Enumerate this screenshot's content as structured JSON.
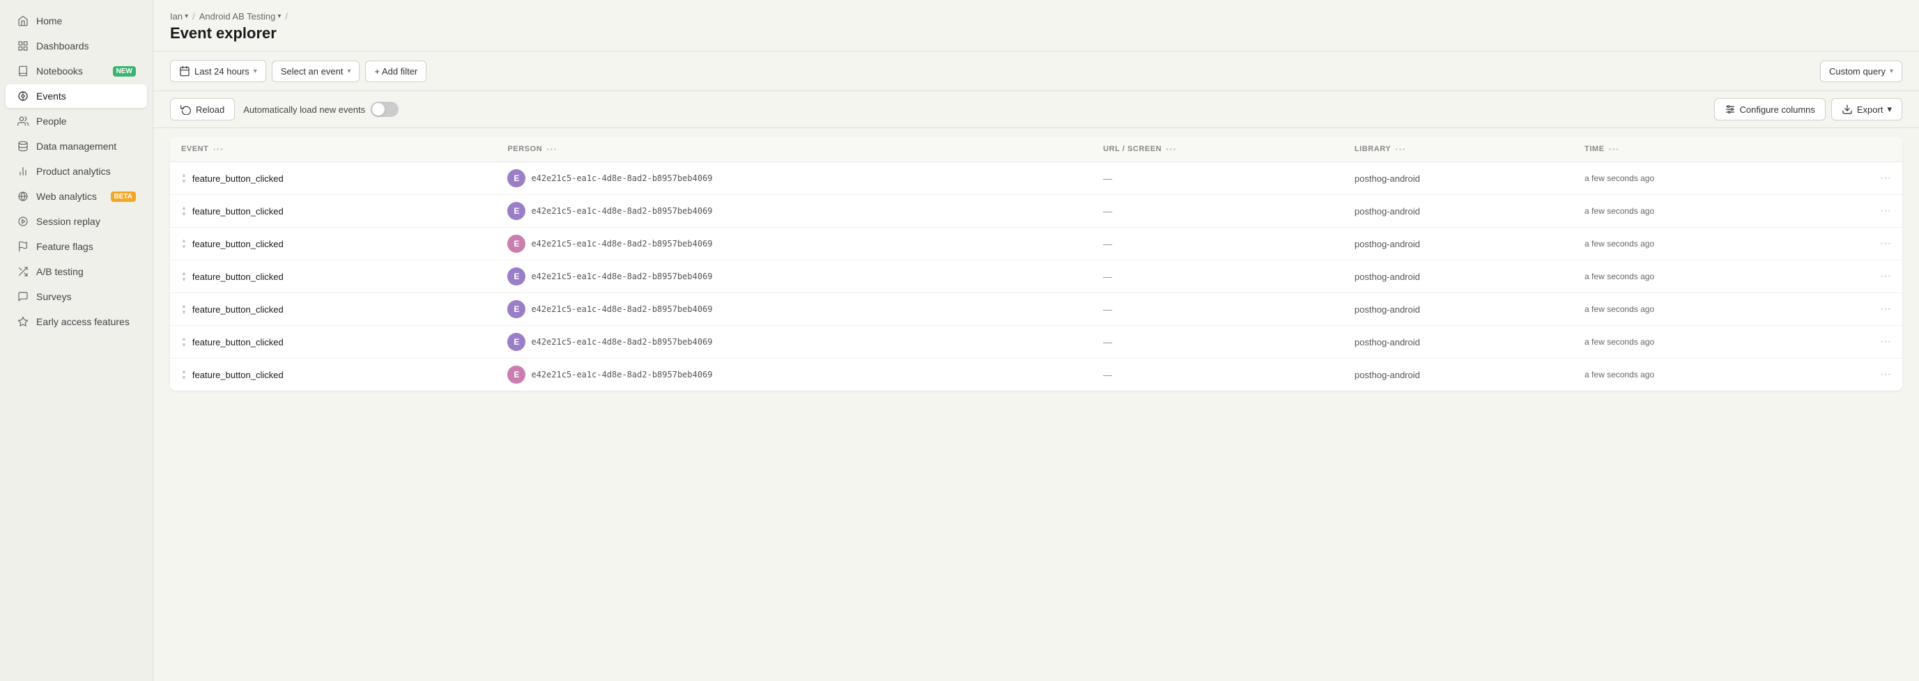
{
  "sidebar": {
    "items": [
      {
        "id": "home",
        "label": "Home",
        "icon": "home-icon",
        "active": false,
        "badge": null
      },
      {
        "id": "dashboards",
        "label": "Dashboards",
        "icon": "dashboard-icon",
        "active": false,
        "badge": null
      },
      {
        "id": "notebooks",
        "label": "Notebooks",
        "icon": "notebook-icon",
        "active": false,
        "badge": "NEW"
      },
      {
        "id": "events",
        "label": "Events",
        "icon": "events-icon",
        "active": true,
        "badge": null
      },
      {
        "id": "people",
        "label": "People",
        "icon": "people-icon",
        "active": false,
        "badge": null
      },
      {
        "id": "data-management",
        "label": "Data management",
        "icon": "data-icon",
        "active": false,
        "badge": null
      },
      {
        "id": "product-analytics",
        "label": "Product analytics",
        "icon": "analytics-icon",
        "active": false,
        "badge": null
      },
      {
        "id": "web-analytics",
        "label": "Web analytics",
        "icon": "web-icon",
        "active": false,
        "badge": "BETA"
      },
      {
        "id": "session-replay",
        "label": "Session replay",
        "icon": "replay-icon",
        "active": false,
        "badge": null
      },
      {
        "id": "feature-flags",
        "label": "Feature flags",
        "icon": "flags-icon",
        "active": false,
        "badge": null
      },
      {
        "id": "ab-testing",
        "label": "A/B testing",
        "icon": "ab-icon",
        "active": false,
        "badge": null
      },
      {
        "id": "surveys",
        "label": "Surveys",
        "icon": "surveys-icon",
        "active": false,
        "badge": null
      },
      {
        "id": "early-access",
        "label": "Early access features",
        "icon": "early-icon",
        "active": false,
        "badge": null
      }
    ]
  },
  "breadcrumb": {
    "items": [
      {
        "label": "Ian",
        "has_chevron": true
      },
      {
        "label": "Android AB Testing",
        "has_chevron": true
      },
      {
        "label": "",
        "has_chevron": false
      }
    ]
  },
  "header": {
    "title": "Event explorer"
  },
  "toolbar": {
    "time_filter": "Last 24 hours",
    "event_select": "Select an event",
    "add_filter": "+ Add filter",
    "custom_query": "Custom query"
  },
  "actions": {
    "reload_label": "Reload",
    "auto_load_label": "Automatically load new events",
    "auto_load_on": false,
    "configure_columns": "Configure columns",
    "export": "Export"
  },
  "table": {
    "columns": [
      {
        "id": "event",
        "label": "EVENT"
      },
      {
        "id": "person",
        "label": "PERSON"
      },
      {
        "id": "url_screen",
        "label": "URL / SCREEN"
      },
      {
        "id": "library",
        "label": "LIBRARY"
      },
      {
        "id": "time",
        "label": "TIME"
      }
    ],
    "rows": [
      {
        "event": "feature_button_clicked",
        "person_avatar": "E",
        "person_color": "#9b7ec8",
        "person_id": "e42e21c5-ea1c-4d8e-8ad2-b8957beb4069",
        "url": "—",
        "library": "posthog-android",
        "time": "a few seconds ago"
      },
      {
        "event": "feature_button_clicked",
        "person_avatar": "E",
        "person_color": "#9b7ec8",
        "person_id": "e42e21c5-ea1c-4d8e-8ad2-b8957beb4069",
        "url": "—",
        "library": "posthog-android",
        "time": "a few seconds ago"
      },
      {
        "event": "feature_button_clicked",
        "person_avatar": "E",
        "person_color": "#c97eb0",
        "person_id": "e42e21c5-ea1c-4d8e-8ad2-b8957beb4069",
        "url": "—",
        "library": "posthog-android",
        "time": "a few seconds ago"
      },
      {
        "event": "feature_button_clicked",
        "person_avatar": "E",
        "person_color": "#9b7ec8",
        "person_id": "e42e21c5-ea1c-4d8e-8ad2-b8957beb4069",
        "url": "—",
        "library": "posthog-android",
        "time": "a few seconds ago"
      },
      {
        "event": "feature_button_clicked",
        "person_avatar": "E",
        "person_color": "#9b7ec8",
        "person_id": "e42e21c5-ea1c-4d8e-8ad2-b8957beb4069",
        "url": "—",
        "library": "posthog-android",
        "time": "a few seconds ago"
      },
      {
        "event": "feature_button_clicked",
        "person_avatar": "E",
        "person_color": "#9b7ec8",
        "person_id": "e42e21c5-ea1c-4d8e-8ad2-b8957beb4069",
        "url": "—",
        "library": "posthog-android",
        "time": "a few seconds ago"
      },
      {
        "event": "feature_button_clicked",
        "person_avatar": "E",
        "person_color": "#c97eb0",
        "person_id": "e42e21c5-ea1c-4d8e-8ad2-b8957beb4069",
        "url": "—",
        "library": "posthog-android",
        "time": "a few seconds ago"
      }
    ]
  }
}
